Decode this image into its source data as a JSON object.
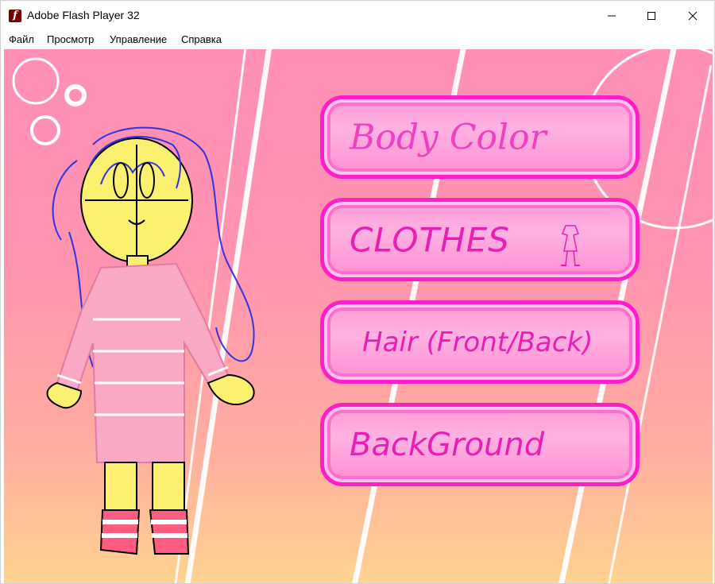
{
  "window": {
    "title": "Adobe Flash Player 32",
    "icon": "flash-player-icon",
    "controls": [
      "minimize-icon",
      "maximize-icon",
      "close-icon"
    ]
  },
  "menubar": {
    "items": [
      "Файл",
      "Просмотр",
      "Управление",
      "Справка"
    ]
  },
  "game": {
    "buttons": [
      {
        "label": "Body Color"
      },
      {
        "label": "CLOTHES",
        "icon": "dress-icon"
      },
      {
        "label": "Hair (Front/Back)"
      },
      {
        "label": "BackGround"
      }
    ],
    "colors": {
      "background_top": "#ff8fb6",
      "background_bottom": "#ffd391",
      "button_border": "#ff1fc8",
      "button_fill": "#ff9ad6",
      "button_text": "#e81fb5"
    }
  }
}
